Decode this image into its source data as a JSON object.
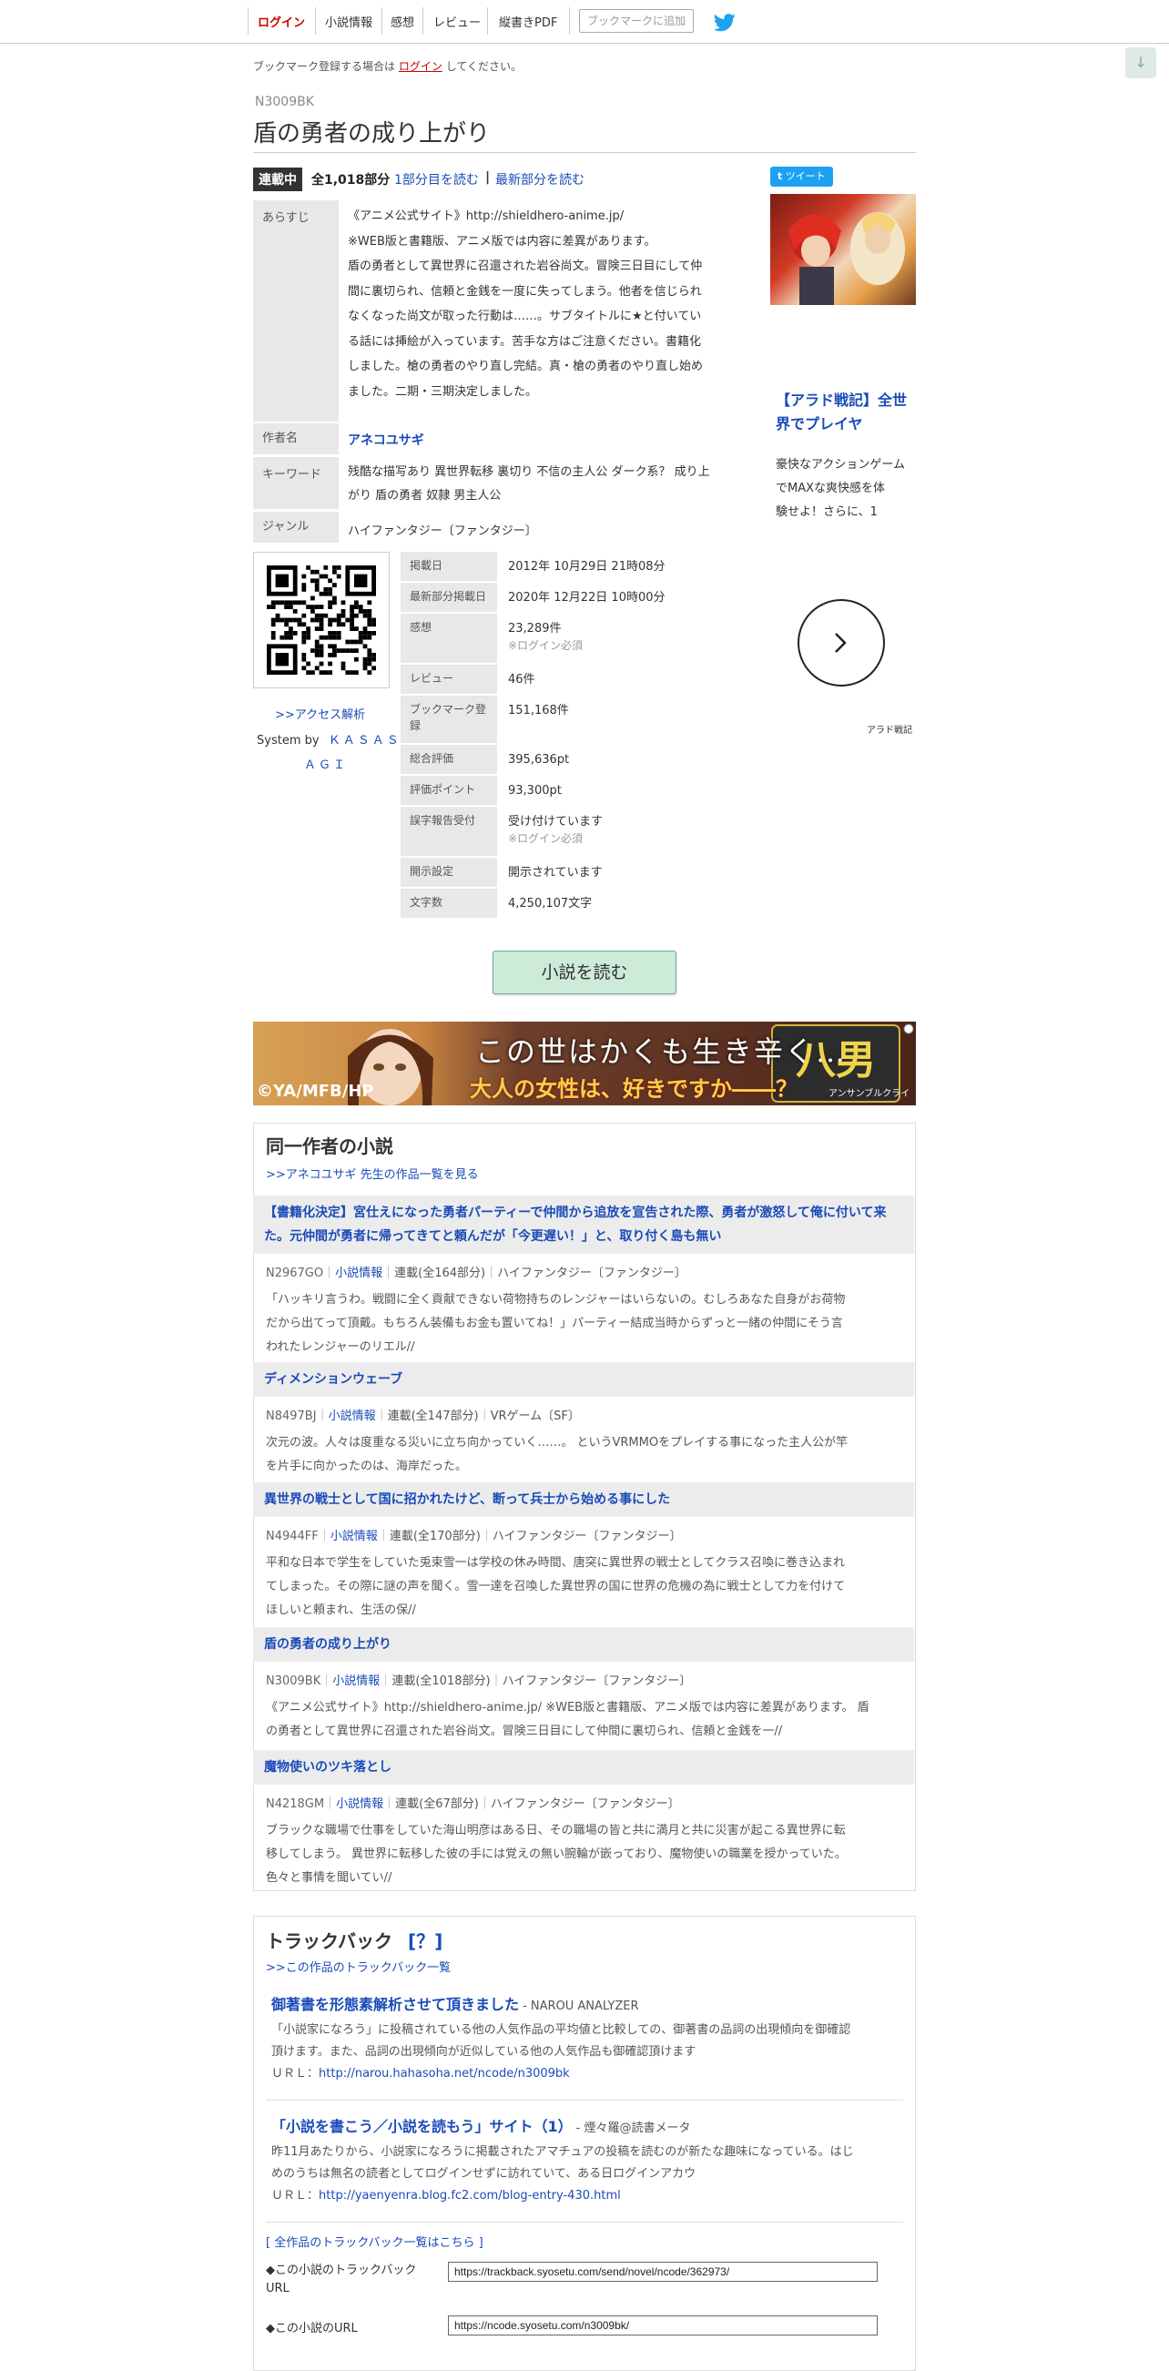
{
  "nav": {
    "login": "ログイン",
    "novel_info": "小説情報",
    "impressions": "感想",
    "review": "レビュー",
    "pdf": "縦書きPDF",
    "bookmark_add": "ブックマークに追加"
  },
  "scroll_top_icon": "↓",
  "bookmark_notice": {
    "prefix": "ブックマーク登録する場合は",
    "link": "ログイン",
    "suffix": "してください。"
  },
  "novel": {
    "ncode": "N3009BK",
    "title": "盾の勇者の成り上がり",
    "status_badge": "連載中",
    "parts": "全1,018部分",
    "read_first": "1部分目を読む",
    "separator": "|",
    "read_latest": "最新部分を読む"
  },
  "info": {
    "synopsis_label": "あらすじ",
    "synopsis_lines": [
      "《アニメ公式サイト》http://shieldhero-anime.jp/",
      "※WEB版と書籍版、アニメ版では内容に差異があります。",
      "盾の勇者として異世界に召還された岩谷尚文。冒険三日目にして仲",
      "間に裏切られ、信頼と金銭を一度に失ってしまう。他者を信じられ",
      "なくなった尚文が取った行動は……。サブタイトルに★と付いてい",
      "る話には挿絵が入っています。苦手な方はご注意ください。書籍化",
      "しました。槍の勇者のやり直し完結。真・槍の勇者のやり直し始め",
      "ました。二期・三期決定しました。"
    ],
    "author_label": "作者名",
    "author": "アネコユサギ",
    "keyword_label": "キーワード",
    "keywords_line1": "残酷な描写あり 異世界転移 裏切り 不信の主人公 ダーク系？ 成り上",
    "keywords_line2": "がり 盾の勇者 奴隷 男主人公",
    "genre_label": "ジャンル",
    "genre": "ハイファンタジー〔ファンタジー〕"
  },
  "stats": [
    {
      "label": "掲載日",
      "value": "2012年 10月29日 21時08分"
    },
    {
      "label": "最新部分掲載日",
      "value": "2020年 12月22日 10時00分"
    },
    {
      "label": "感想",
      "value": "23,289件",
      "note": "※ログイン必須"
    },
    {
      "label": "レビュー",
      "value": "46件"
    },
    {
      "label": "ブックマーク登録",
      "value": "151,168件"
    },
    {
      "label": "総合評価",
      "value": "395,636pt"
    },
    {
      "label": "評価ポイント",
      "value": "93,300pt"
    },
    {
      "label": "誤字報告受付",
      "value": "受け付けています",
      "note": "※ログイン必須"
    },
    {
      "label": "開示設定",
      "value": "開示されています"
    },
    {
      "label": "文字数",
      "value": "4,250,107文字"
    }
  ],
  "qr": {
    "access_link": ">>アクセス解析",
    "system_by": "System by",
    "kasasagi1": "ＫＡＳＡＳ",
    "kasasagi2": "ＡＧＩ"
  },
  "read_button": "小説を読む",
  "ad": {
    "tweet": "ツイート",
    "title": "【アラド戦記】全世界でプレイヤ",
    "desc_lines": [
      "豪快なアクションゲーム",
      "でMAXな爽快感を体",
      "験せよ！さらに、1"
    ],
    "next_icon": "chevron-right-icon",
    "source": "アラド戦記",
    "banner_text1": "この世はかくも生き辛く…",
    "banner_text2": "大人の女性は、好きですか――？",
    "banner_copyright": "©YA/MFB/HP",
    "banner_logo": "八男",
    "banner_logo_sub": "アンサンブルクライ"
  },
  "same_author": {
    "heading": "同一作者の小説",
    "list_link": ">>アネコユサギ 先生の作品一覧を見る",
    "novels": [
      {
        "title_lines": [
          "【書籍化決定】宮仕えになった勇者パーティーで仲間から追放を宣告された際、勇者が激怒して俺に付いて来",
          "た。元仲間が勇者に帰ってきてと頼んだが「今更遅い！」と、取り付く島も無い"
        ],
        "code": "N2967GO",
        "info_link": "小説情報",
        "status": "連載(全164部分)",
        "genre": "ハイファンタジー〔ファンタジー〕",
        "desc_lines": [
          "「ハッキリ言うわ。戦闘に全く貢献できない荷物持ちのレンジャーはいらないの。むしろあなた自身がお荷物",
          "だから出てって頂戴。もちろん装備もお金も置いてね！」パーティー結成当時からずっと一緒の仲間にそう言",
          "われたレンジャーのリエル//"
        ]
      },
      {
        "title_lines": [
          "ディメンションウェーブ"
        ],
        "code": "N8497BJ",
        "info_link": "小説情報",
        "status": "連載(全147部分)",
        "genre": "VRゲーム〔SF〕",
        "desc_lines": [
          "次元の波。人々は度重なる災いに立ち向かっていく……。 というVRMMOをプレイする事になった主人公が竿",
          "を片手に向かったのは、海岸だった。"
        ]
      },
      {
        "title_lines": [
          "異世界の戦士として国に招かれたけど、断って兵士から始める事にした"
        ],
        "code": "N4944FF",
        "info_link": "小説情報",
        "status": "連載(全170部分)",
        "genre": "ハイファンタジー〔ファンタジー〕",
        "desc_lines": [
          "平和な日本で学生をしていた兎束雪一は学校の休み時間、唐突に異世界の戦士としてクラス召喚に巻き込まれ",
          "てしまった。その際に謎の声を聞く。雪一達を召喚した異世界の国に世界の危機の為に戦士として力を付けて",
          "ほしいと頼まれ、生活の保//"
        ]
      },
      {
        "title_lines": [
          "盾の勇者の成り上がり"
        ],
        "code": "N3009BK",
        "info_link": "小説情報",
        "status": "連載(全1018部分)",
        "genre": "ハイファンタジー〔ファンタジー〕",
        "desc_lines": [
          "《アニメ公式サイト》http://shieldhero-anime.jp/ ※WEB版と書籍版、アニメ版では内容に差異があります。 盾",
          "の勇者として異世界に召還された岩谷尚文。冒険三日目にして仲間に裏切られ、信頼と金銭を一//"
        ]
      },
      {
        "title_lines": [
          "魔物使いのツキ落とし"
        ],
        "code": "N4218GM",
        "info_link": "小説情報",
        "status": "連載(全67部分)",
        "genre": "ハイファンタジー〔ファンタジー〕",
        "desc_lines": [
          "ブラックな職場で仕事をしていた海山明彦はある日、その職場の皆と共に満月と共に災害が起こる異世界に転",
          "移してしまう。 異世界に転移した彼の手には覚えの無い腕輪が嵌っており、魔物使いの職業を授かっていた。",
          "色々と事情を聞いてい//"
        ]
      }
    ]
  },
  "trackback": {
    "heading": "トラックバック",
    "help": "[？]",
    "list_link": ">>この作品のトラックバック一覧",
    "entries": [
      {
        "title": "御著書を形態素解析させて頂きました",
        "source": "- NAROU ANALYZER",
        "desc_lines": [
          "「小説家になろう」に投稿されている他の人気作品の平均値と比較しての、御著書の品詞の出現傾向を御確認",
          "頂けます。また、品詞の出現傾向が近似している他の人気作品も御確認頂けます"
        ],
        "url_label": "ＵＲＬ：",
        "url": "http://narou.hahasoha.net/ncode/n3009bk"
      },
      {
        "title": "「小説を書こう／小説を読もう」サイト（1）",
        "source": "- 煙々羅@読書メータ",
        "desc_lines": [
          "昨11月あたりから、小説家になろうに掲載されたアマチュアの投稿を読むのが新たな趣味になっている。はじ",
          "めのうちは無名の読者としてログインせずに訪れていて、ある日ログインアカウ"
        ],
        "url_label": "ＵＲＬ：",
        "url": "http://yaenyenra.blog.fc2.com/blog-entry-430.html"
      }
    ],
    "all_link": "[ 全作品のトラックバック一覧はこちら ]",
    "tb_url_label1": "◆この小説のトラックバック",
    "tb_url_label2": "URL",
    "tb_url_value": "https://trackback.syosetu.com/send/novel/ncode/362973/",
    "novel_url_label": "◆この小説のURL",
    "novel_url_value": "https://ncode.syosetu.com/n3009bk/"
  }
}
